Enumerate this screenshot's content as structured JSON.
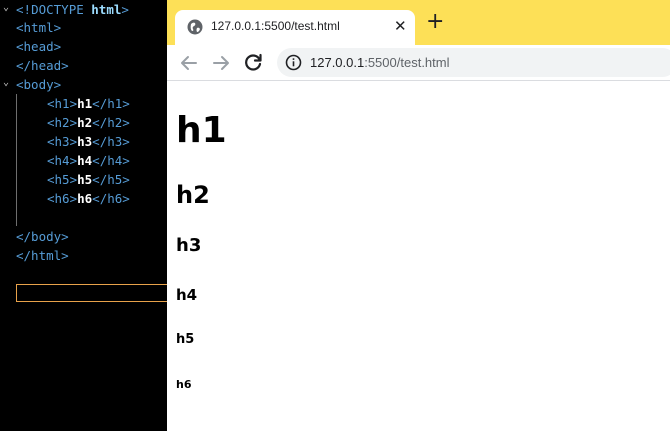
{
  "editor": {
    "doctype": {
      "open": "<!",
      "keyword": "DOCTYPE",
      "name": "html",
      "close": ">"
    },
    "html_open": "<html>",
    "head_open": "<head>",
    "head_close": "</head>",
    "body_open": "<body>",
    "headings": [
      {
        "open": "<h1>",
        "text": "h1",
        "close": "</h1>"
      },
      {
        "open": "<h2>",
        "text": "h2",
        "close": "</h2>"
      },
      {
        "open": "<h3>",
        "text": "h3",
        "close": "</h3>"
      },
      {
        "open": "<h4>",
        "text": "h4",
        "close": "</h4>"
      },
      {
        "open": "<h5>",
        "text": "h5",
        "close": "</h5>"
      },
      {
        "open": "<h6>",
        "text": "h6",
        "close": "</h6>"
      }
    ],
    "body_close": "</body>",
    "html_close": "</html>",
    "fold_chevron": "⌄"
  },
  "browser": {
    "tab_title": "127.0.0.1:5500/test.html",
    "tab_close": "✕",
    "new_tab": "+",
    "url_host": "127.0.0.1",
    "url_rest": ":5500/test.html",
    "accent_color": "#fde057"
  },
  "page": {
    "h1": "h1",
    "h2": "h2",
    "h3": "h3",
    "h4": "h4",
    "h5": "h5",
    "h6": "h6"
  }
}
